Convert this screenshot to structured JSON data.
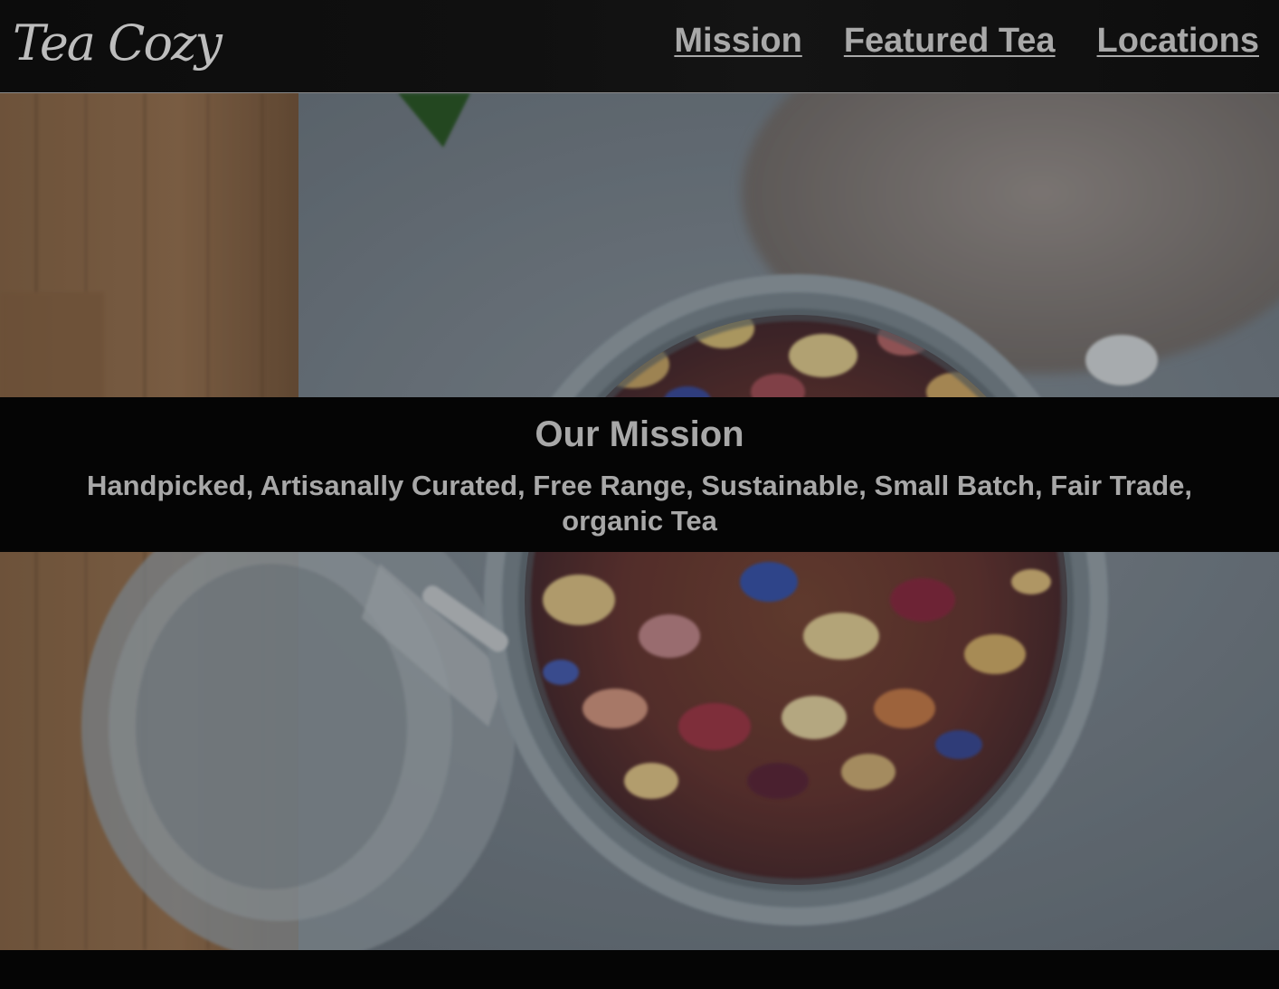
{
  "header": {
    "logo_text": "Tea Cozy",
    "nav": [
      {
        "label": "Mission"
      },
      {
        "label": "Featured Tea"
      },
      {
        "label": "Locations"
      }
    ]
  },
  "mission": {
    "title": "Our Mission",
    "text": "Handpicked, Artisanally Curated, Free Range, Sustainable, Small Batch, Fair Trade, organic Tea"
  },
  "colors": {
    "header_bg": "#0f0f0f",
    "nav_text": "#a9a9a9",
    "band_bg": "#050505",
    "band_text": "#a8a8a8"
  }
}
